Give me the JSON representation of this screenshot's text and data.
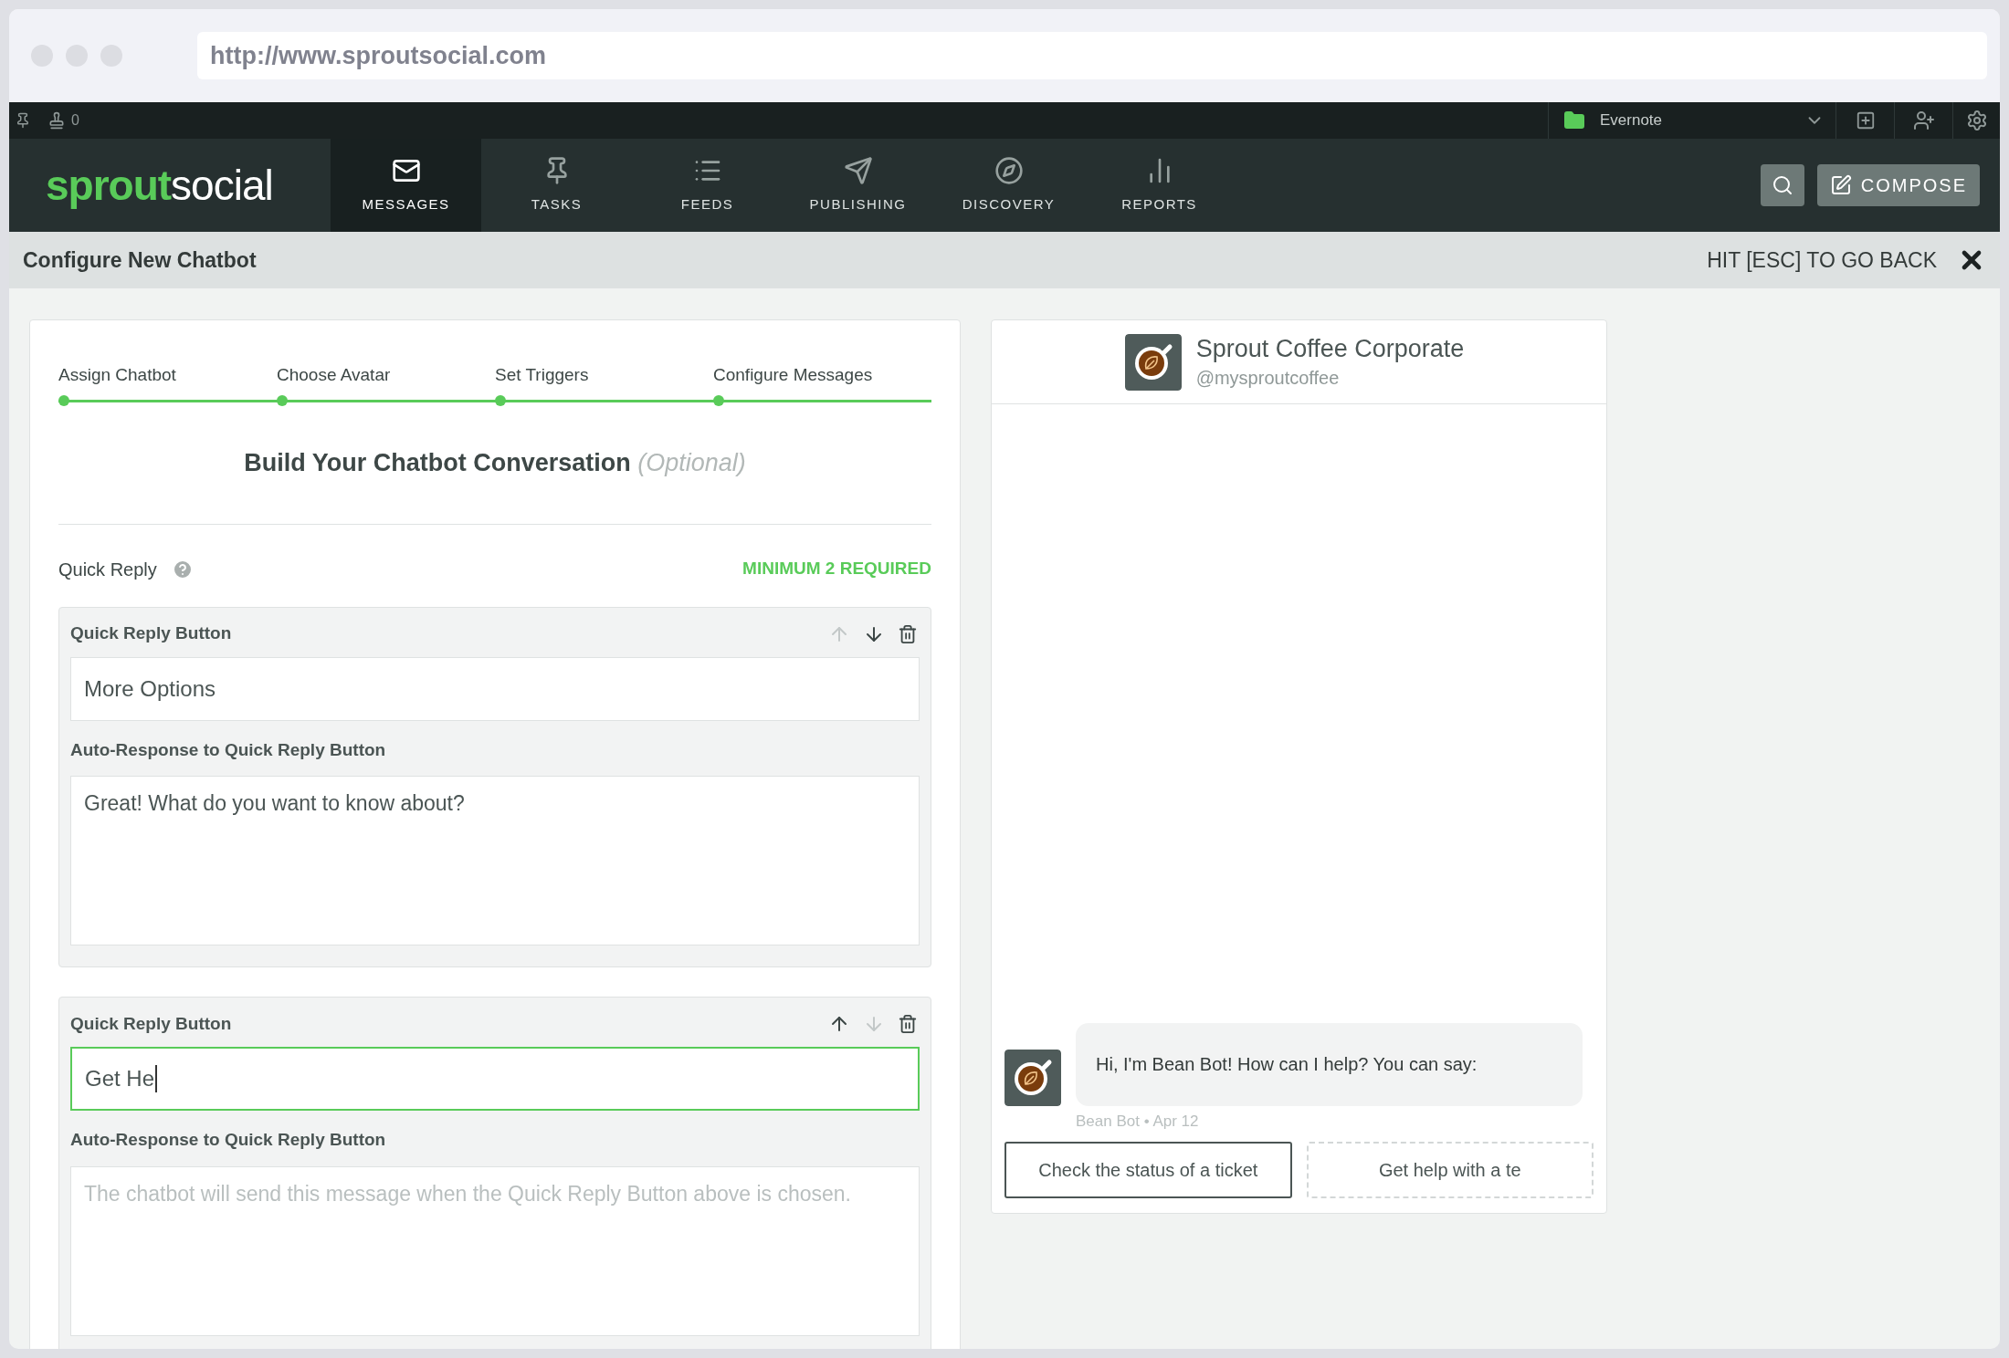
{
  "browser": {
    "url": "http://www.sproutsocial.com"
  },
  "top_strip": {
    "count": "0",
    "account": "Evernote"
  },
  "logo": {
    "first": "sprout",
    "second": "social"
  },
  "nav": [
    {
      "label": "MESSAGES",
      "selected": true
    },
    {
      "label": "TASKS",
      "selected": false
    },
    {
      "label": "FEEDS",
      "selected": false
    },
    {
      "label": "PUBLISHING",
      "selected": false
    },
    {
      "label": "DISCOVERY",
      "selected": false
    },
    {
      "label": "REPORTS",
      "selected": false
    }
  ],
  "compose": "COMPOSE",
  "page": {
    "title": "Configure New Chatbot",
    "back_hint": "HIT [ESC] TO GO BACK"
  },
  "steps": [
    {
      "label": "Assign Chatbot",
      "completed": true
    },
    {
      "label": "Choose Avatar",
      "completed": true
    },
    {
      "label": "Set Triggers",
      "completed": true
    },
    {
      "label": "Configure Messages",
      "completed": true
    }
  ],
  "section": {
    "title": "Build Your Chatbot Conversation",
    "note": "(Optional)"
  },
  "quick_reply": {
    "label": "Quick Reply",
    "requirement": "MINIMUM 2 REQUIRED"
  },
  "quick_reply_buttons": [
    {
      "title": "Quick Reply Button",
      "up_disabled": true,
      "down_disabled": false,
      "value": "More Options",
      "focused": false,
      "response_label": "Auto-Response to Quick Reply Button",
      "response": "Great! What do you want to know about?"
    },
    {
      "title": "Quick Reply Button",
      "up_disabled": false,
      "down_disabled": true,
      "value": "Get He",
      "focused": true,
      "response_label": "Auto-Response to Quick Reply Button",
      "response_placeholder": "The chatbot will send this message when the Quick Reply Button above is chosen."
    }
  ],
  "preview": {
    "name": "Sprout Coffee Corporate",
    "handle": "@mysproutcoffee",
    "message": "Hi, I'm Bean Bot! How can I help? You can say:",
    "caption": "Bean Bot • Apr 12",
    "replies": [
      {
        "label": "Check the status of a ticket",
        "kind": "saved"
      },
      {
        "label": "Get help with a te",
        "kind": "draft"
      }
    ]
  }
}
